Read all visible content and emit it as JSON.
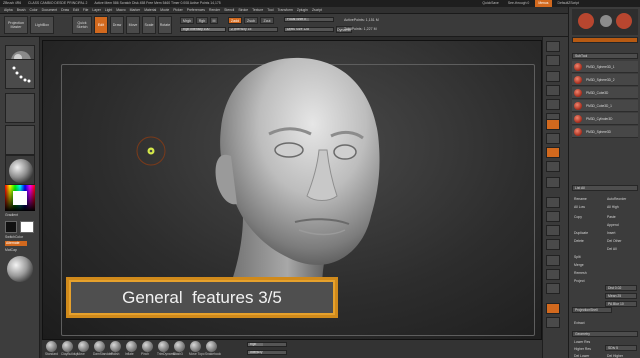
{
  "title_bar": {
    "app": "ZBrush 4R6",
    "document": "CLASS CAMBIO DESDE PRINCIPAL 2",
    "stats": "Active Mem 586  Scratch Disk 458  Free Mem 5460  Timer 0.008  Active Points 14,175",
    "quicksave": "QuickSave",
    "see_through": "See-through 0",
    "menus": "Menus",
    "default_script": "DefaultZScript"
  },
  "menu_items": [
    "Alpha",
    "Brush",
    "Color",
    "Document",
    "Draw",
    "Edit",
    "File",
    "Layer",
    "Light",
    "Macro",
    "Marker",
    "Material",
    "Movie",
    "Picker",
    "Preferences",
    "Render",
    "Stencil",
    "Stroke",
    "Texture",
    "Tool",
    "Transform",
    "Zplugin",
    "Zscript"
  ],
  "toolbar": {
    "projection_master": "Projection Master",
    "lightbox": "LightBox",
    "quick_sketch": "Quick Sketch",
    "edit": "Edit",
    "draw": "Draw",
    "move": "Move",
    "scale": "Scale",
    "rotate": "Rotate",
    "mrgb": "Mrgb",
    "rgb": "Rgb",
    "m": "M",
    "rgb_intensity": "Rgb Intensity 100",
    "zadd": "Zadd",
    "zsub": "Zsub",
    "zcut": "Zcut",
    "z_intensity": "Z Intensity 15",
    "focal_shift": "Focal Shift 0",
    "draw_size": "Draw Size 128",
    "dynamic": "Dynamic",
    "active_points": "ActivePoints: 1,151 M",
    "total_points": "TotalPoints: 1,227 M"
  },
  "left_shelf": {
    "gradient_label": "Gradient",
    "switch_color_label": "SwitchColor",
    "alternate_label": "Alternate",
    "matcap_label": "MatCap"
  },
  "caption": "General  features 3/5",
  "brushes": [
    "Standard",
    "ClayBuildup",
    "Move",
    "DamStandard",
    "hPolish",
    "Inflate",
    "Pinch",
    "TrimDynamic",
    "Slash3",
    "Move Topo",
    "Snakehook"
  ],
  "bottom_sliders": {
    "rgb_label": "Rgb",
    "intensity_label": "Intensity"
  },
  "tray": {
    "subtool_title": "SubTool",
    "subtools": [
      "PM3D_Sphere3D_1",
      "PM3D_Sphere3D_2",
      "PM3D_Cube3D",
      "PM3D_Cube3D_1",
      "PM3D_Cylinder3D",
      "PM3D_Sphere3D"
    ],
    "list_all": "List All",
    "rename": "Rename",
    "auto_reorder": "AutoReorder",
    "all_low": "All Low",
    "all_high": "All High",
    "copy": "Copy",
    "paste": "Paste",
    "append": "Append",
    "duplicate": "Duplicate",
    "insert": "Insert",
    "delete": "Delete",
    "del_other": "Del Other",
    "del_all": "Del All",
    "split": "Split",
    "merge": "Merge",
    "remesh": "Remesh",
    "project": "Project",
    "dist": "Dist 0.02",
    "mean": "Mean 25",
    "pa_blur": "PA Blur 10",
    "project_basrelief": "ProjectionShell",
    "extract": "Extract",
    "geometry": "Geometry",
    "lower_res": "Lower Res",
    "higher_res": "Higher Res",
    "sdiv": "SDiv 5",
    "del_lower": "Del Lower",
    "del_higher": "Del Higher"
  },
  "colors": {
    "accent": "#d2691e",
    "caption_border": "#e6a12c",
    "caption_bg": "#4f4f4f",
    "subtool_sphere": "#c0392b"
  }
}
